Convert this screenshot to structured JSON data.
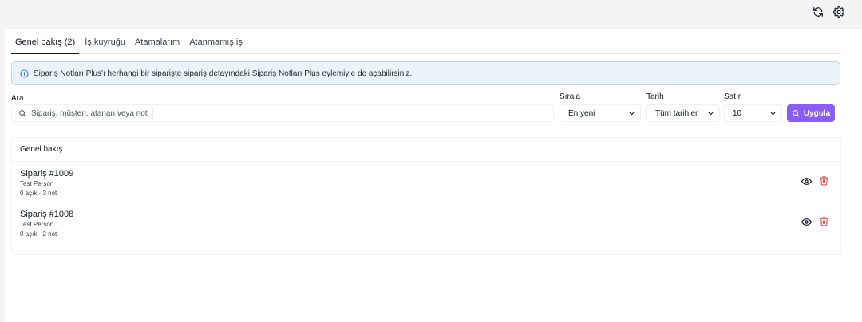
{
  "toolbar": {
    "refresh_icon": "refresh-icon",
    "settings_icon": "gear-icon"
  },
  "tabs": [
    {
      "label": "Genel bakış (2)",
      "active": true
    },
    {
      "label": "İş kuyruğu",
      "active": false
    },
    {
      "label": "Atamalarım",
      "active": false
    },
    {
      "label": "Atanmamış iş",
      "active": false
    }
  ],
  "info": {
    "text": "Sipariş Notları Plus'ı herhangi bir siparişte sipariş detayındaki Sipariş Notları Plus eylemiyle de açabilirsiniz."
  },
  "filters": {
    "search_label": "Ara",
    "search_placeholder": "Sipariş, müşteri, atanan veya not",
    "sort_label": "Sırala",
    "sort_value": "En yeni",
    "date_label": "Tarih",
    "date_value": "Tüm tarihler",
    "rows_label": "Satır",
    "rows_value": "10",
    "apply_label": "Uygula"
  },
  "overview": {
    "header": "Genel bakış",
    "rows": [
      {
        "title": "Sipariş #1009",
        "customer": "Test Person",
        "meta": "0 açık · 3 not"
      },
      {
        "title": "Sipariş #1008",
        "customer": "Test Person",
        "meta": "0 açık · 2 not"
      }
    ]
  },
  "colors": {
    "accent": "#8b5cf6",
    "danger": "#ef4444",
    "info_bg": "#eaf3fb",
    "info_border": "#bcd6ee"
  }
}
